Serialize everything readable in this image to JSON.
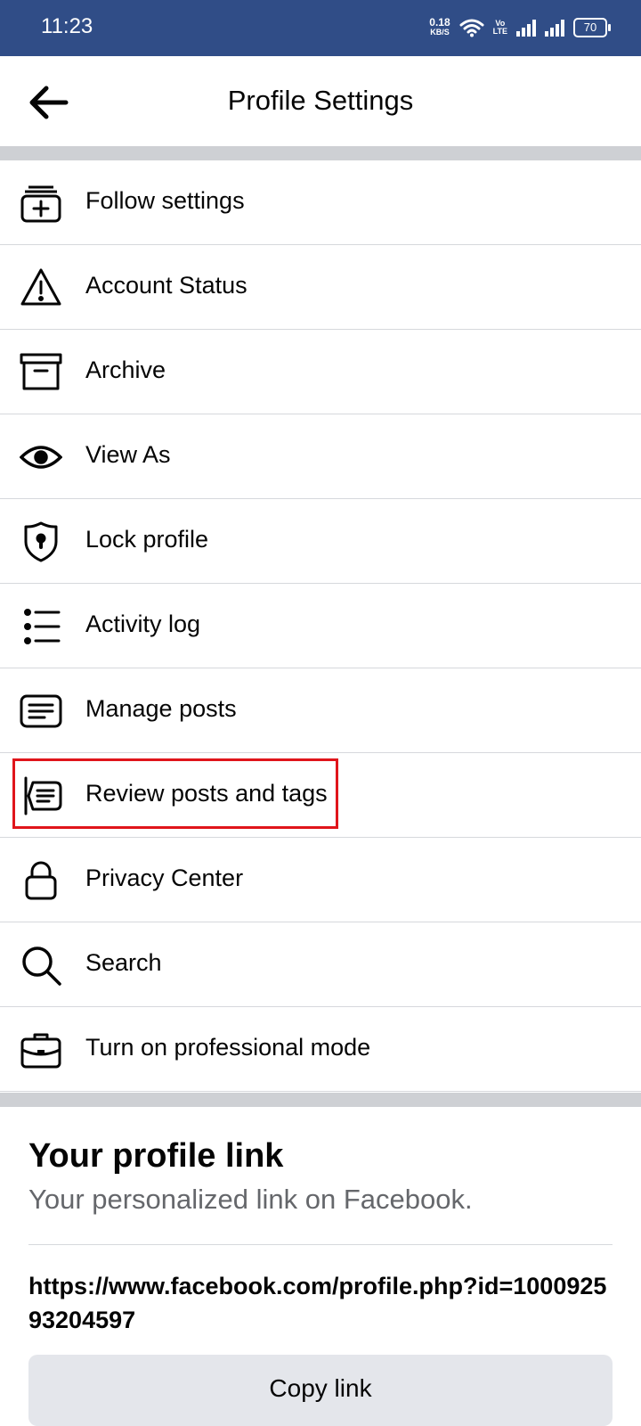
{
  "status_bar": {
    "time": "11:23",
    "net_speed_value": "0.18",
    "net_speed_unit": "KB/S",
    "volte_top": "Vo",
    "volte_bottom": "LTE",
    "battery": "70"
  },
  "header": {
    "title": "Profile Settings",
    "back_icon": "arrow-left-icon"
  },
  "menu": [
    {
      "label": "Follow settings",
      "icon": "follow-stack-icon"
    },
    {
      "label": "Account Status",
      "icon": "warning-triangle-icon"
    },
    {
      "label": "Archive",
      "icon": "archive-box-icon"
    },
    {
      "label": "View As",
      "icon": "eye-icon"
    },
    {
      "label": "Lock profile",
      "icon": "shield-lock-icon"
    },
    {
      "label": "Activity log",
      "icon": "list-icon"
    },
    {
      "label": "Manage posts",
      "icon": "posts-icon"
    },
    {
      "label": "Review posts and tags",
      "icon": "review-posts-icon"
    },
    {
      "label": "Privacy Center",
      "icon": "padlock-icon"
    },
    {
      "label": "Search",
      "icon": "search-icon"
    },
    {
      "label": "Turn on professional mode",
      "icon": "briefcase-icon"
    }
  ],
  "highlight_color": "#e0151b",
  "profile_link": {
    "title": "Your profile link",
    "subtitle": "Your personalized link on Facebook.",
    "url": "https://www.facebook.com/profile.php?id=100092593204597",
    "copy_button": "Copy link"
  },
  "colors": {
    "status_bar": "#304d87",
    "separator": "#ced0d4",
    "button_bg": "#e4e6eb",
    "subtitle": "#65676b"
  }
}
